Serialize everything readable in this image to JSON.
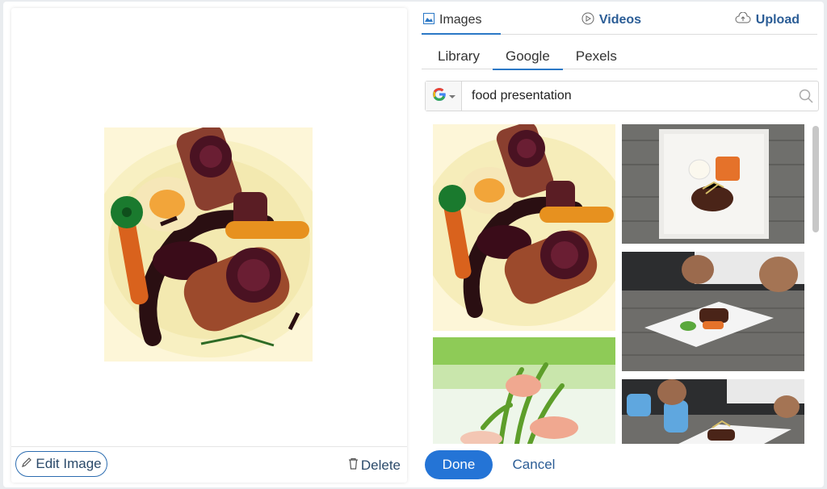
{
  "tabs": {
    "images": "Images",
    "videos": "Videos",
    "upload": "Upload"
  },
  "sources": {
    "library": "Library",
    "google": "Google",
    "pexels": "Pexels",
    "active": "Google"
  },
  "search": {
    "value": "food presentation",
    "provider_icon": "google-icon"
  },
  "preview": {
    "edit_label": "Edit Image",
    "delete_label": "Delete"
  },
  "footer": {
    "done_label": "Done",
    "cancel_label": "Cancel"
  },
  "colors": {
    "accent": "#2474d6",
    "link": "#2b5d96"
  }
}
